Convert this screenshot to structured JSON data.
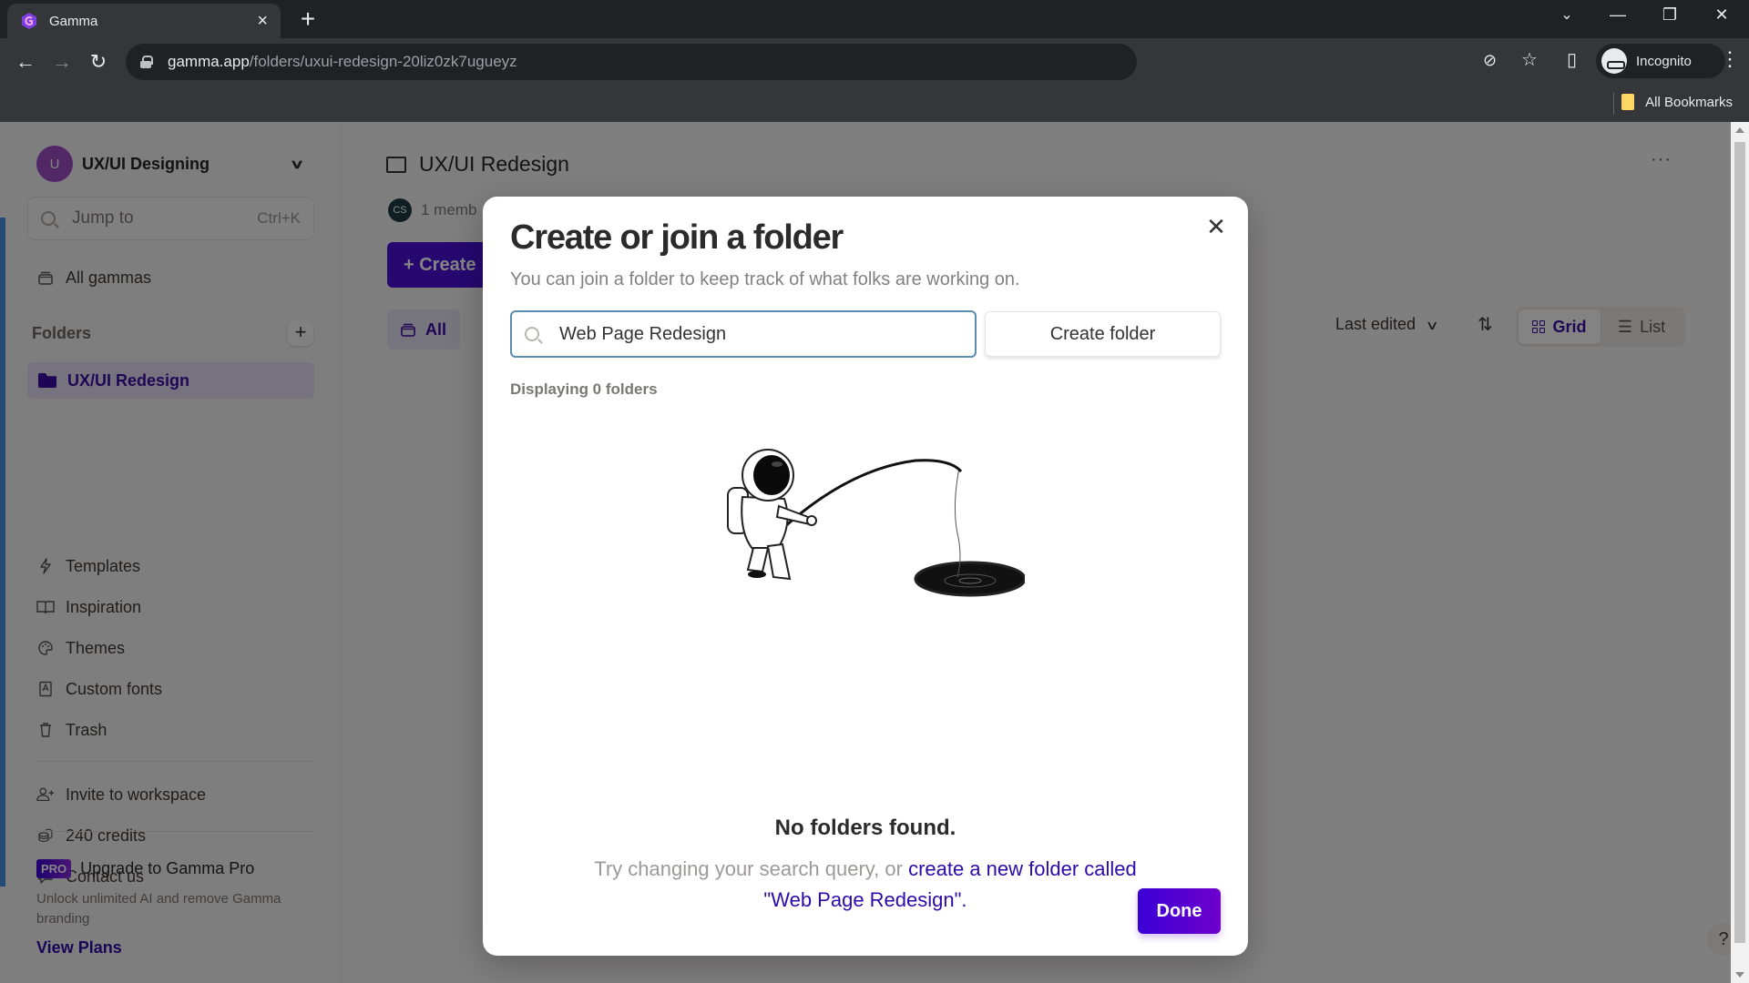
{
  "browser": {
    "tab_title": "Gamma",
    "url_host": "gamma.app",
    "url_path": "/folders/uxui-redesign-20liz0zk7ugueyz",
    "profile_label": "Incognito",
    "bookmarks_label": "All Bookmarks",
    "icons": {
      "back": "←",
      "forward": "→",
      "reload": "↻",
      "eye_off": "⊘",
      "star": "☆",
      "sidepanel": "▯",
      "menu": "⋮",
      "tab_close": "×",
      "new_tab": "+",
      "tab_search": "⌄",
      "minimize": "—",
      "restore": "❐",
      "close": "✕"
    }
  },
  "sidebar": {
    "workspace": {
      "avatar_letter": "U",
      "name": "UX/UI Designing",
      "chevron": "∨"
    },
    "jump": {
      "label": "Jump to",
      "shortcut": "Ctrl+K"
    },
    "all_gammas": "All gammas",
    "folders_label": "Folders",
    "add_folder_icon": "+",
    "folders": [
      {
        "label": "UX/UI Redesign",
        "active": true
      }
    ],
    "nav": [
      {
        "label": "Templates",
        "icon": "⚡"
      },
      {
        "label": "Inspiration",
        "icon": "📖"
      },
      {
        "label": "Themes",
        "icon": "🎨"
      },
      {
        "label": "Custom fonts",
        "icon": "🅰"
      },
      {
        "label": "Trash",
        "icon": "🗑"
      }
    ],
    "secondary": [
      {
        "label": "Invite to workspace",
        "icon": "👤+"
      },
      {
        "label": "240 credits",
        "icon": "🪙"
      },
      {
        "label": "Contact us",
        "icon": "💬"
      }
    ],
    "upgrade": {
      "badge": "PRO",
      "title": "Upgrade to Gamma Pro",
      "description": "Unlock unlimited AI and remove Gamma branding",
      "cta": "View Plans"
    }
  },
  "main": {
    "title": "UX/UI Redesign",
    "member_initials": "CS",
    "members_text": "1 memb",
    "create_label": "+ Create",
    "filter_all": "All",
    "sort_label": "Last edited",
    "sort_chevron": "∨",
    "sort_toggle": "⇅",
    "view_grid": "Grid",
    "view_list": "List",
    "list_icon": "☰",
    "more": "···",
    "help": "?"
  },
  "modal": {
    "title": "Create or join a folder",
    "subtitle": "You can join a folder to keep track of what folks are working on.",
    "search_value": "Web Page Redesign",
    "create_folder_label": "Create folder",
    "count_label": "Displaying 0 folders",
    "empty_title": "No folders found.",
    "empty_desc_prefix": "Try changing your search query, or ",
    "empty_desc_link": "create a new folder called \"Web Page Redesign\".",
    "close_icon": "✕",
    "done_label": "Done"
  },
  "colors": {
    "accent": "#4a11d6",
    "link": "#2e0aa8",
    "active_folder_bg": "#e2ddf3",
    "workspace_avatar": "#9c4cc1"
  }
}
